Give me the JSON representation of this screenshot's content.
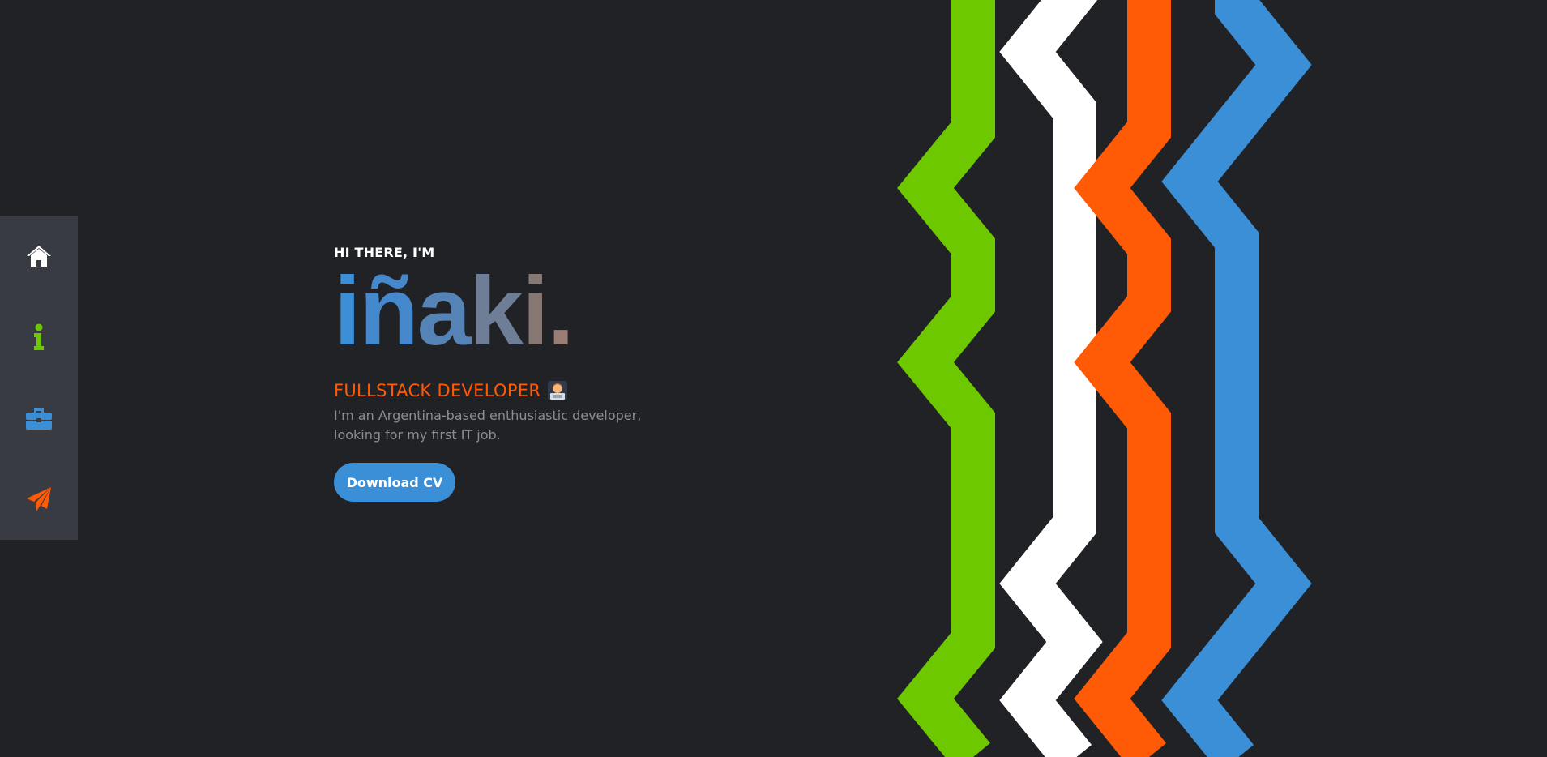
{
  "sidebar": {
    "items": [
      {
        "icon": "home-icon",
        "color": "#ffffff"
      },
      {
        "icon": "info-icon",
        "color": "#6ec800"
      },
      {
        "icon": "briefcase-icon",
        "color": "#3b8fd7"
      },
      {
        "icon": "paper-plane-icon",
        "color": "#ff5a06"
      }
    ]
  },
  "hero": {
    "greeting": "HI THERE, I'M",
    "name_letters": [
      {
        "char": "i",
        "color": "#3b8fd7"
      },
      {
        "char": "ñ",
        "color": "#4589cc"
      },
      {
        "char": "a",
        "color": "#5683b5"
      },
      {
        "char": "k",
        "color": "#6e7e96"
      },
      {
        "char": "i",
        "color": "#887874"
      },
      {
        "char": ".",
        "color": "#9a7d74"
      }
    ],
    "role": "FULLSTACK DEVELOPER",
    "role_icon": "technologist-emoji",
    "description": "I'm an Argentina-based enthusiastic developer, looking for my first IT job.",
    "cv_button": "Download CV"
  },
  "stripes": {
    "colors": [
      "#6ec800",
      "#ffffff",
      "#ff5a06",
      "#3b8fd7"
    ]
  }
}
